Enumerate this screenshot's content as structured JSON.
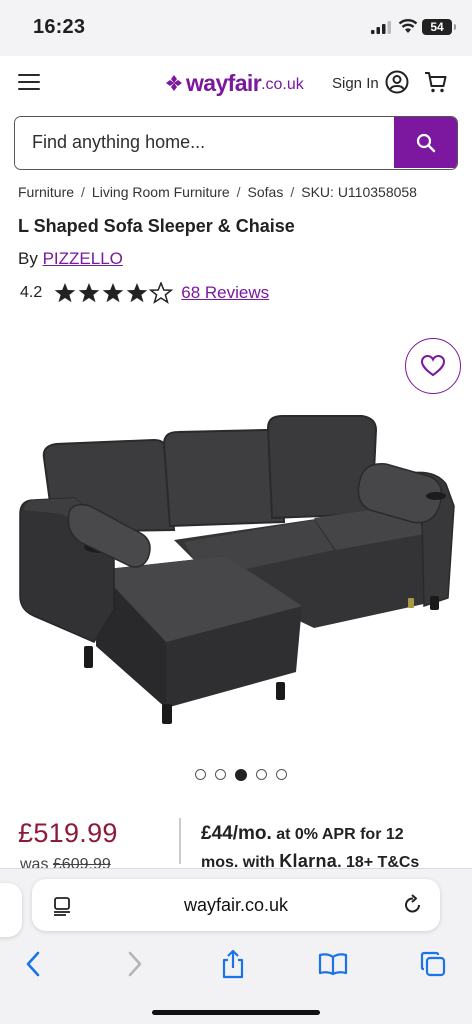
{
  "status_bar": {
    "time": "16:23",
    "battery": "54"
  },
  "header": {
    "logo_word": "wayfair",
    "logo_tld": ".co.uk",
    "sign_in_label": "Sign In",
    "brand_color": "#7b189f"
  },
  "search": {
    "placeholder": "Find anything home..."
  },
  "breadcrumb": {
    "items": [
      "Furniture",
      "Living Room Furniture",
      "Sofas"
    ],
    "separator": "/",
    "sku": "SKU: U110358058"
  },
  "product": {
    "title": "L Shaped Sofa Sleeper & Chaise",
    "by_label": "By",
    "brand": "PIZZELLO",
    "rating": "4.2",
    "stars_filled": 4,
    "stars_total": 5,
    "reviews_label": "68 Reviews",
    "image_dots": 5,
    "active_image_index": 2
  },
  "pricing": {
    "price": "£519.99",
    "was_label": "was",
    "was_price": "£609.99",
    "price_color": "#8e1a3a",
    "finance_amount": "£44/mo.",
    "finance_line1_rest": " at 0% APR for 12",
    "finance_line2_pre": "mos. with ",
    "finance_provider": "Klarna",
    "finance_line2_post": ". 18+ T&Cs"
  },
  "browser": {
    "url": "wayfair.co.uk",
    "icons": [
      "reader-icon",
      "reload-icon",
      "back-icon",
      "forward-icon",
      "share-icon",
      "bookmarks-icon",
      "tabs-icon"
    ],
    "accent": "#1a73e8"
  }
}
